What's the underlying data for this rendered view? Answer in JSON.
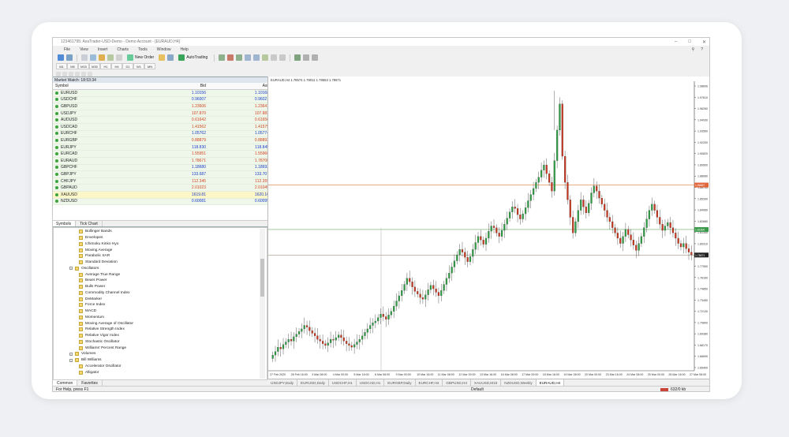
{
  "window": {
    "title": "123461795: AvaTrader-USD-Demo - Demo Account - [EURAUD,H4]"
  },
  "menu": [
    "File",
    "View",
    "Insert",
    "Charts",
    "Tools",
    "Window",
    "Help"
  ],
  "toolbar": {
    "new_order": "New Order",
    "autotrading": "AutoTrading"
  },
  "timeframes": [
    "M1",
    "M5",
    "M15",
    "M30",
    "H1",
    "H4",
    "D1",
    "W1",
    "MN"
  ],
  "market_watch": {
    "header": "Market Watch: 18:53:34",
    "col_symbol": "Symbol",
    "col_bid": "Bid",
    "col_ask": "Ask",
    "rows": [
      {
        "symbol": "EURUSD",
        "bid": "1.10156",
        "ask": "1.10168",
        "dir": "up"
      },
      {
        "symbol": "USDCHF",
        "bid": "0.96007",
        "ask": "0.96021",
        "dir": "up"
      },
      {
        "symbol": "GBPUSD",
        "bid": "1.23606",
        "ask": "1.23641",
        "dir": "dn"
      },
      {
        "symbol": "USDJPY",
        "bid": "107.870",
        "ask": "107.883",
        "dir": "dn"
      },
      {
        "symbol": "AUDUSD",
        "bid": "0.61642",
        "ask": "0.61656",
        "dir": "dn"
      },
      {
        "symbol": "USDCAD",
        "bid": "1.41562",
        "ask": "1.41575",
        "dir": "dn"
      },
      {
        "symbol": "EURCHF",
        "bid": "1.05762",
        "ask": "1.05774",
        "dir": "up"
      },
      {
        "symbol": "EURGBP",
        "bid": "0.88879",
        "ask": "0.88892",
        "dir": "dn"
      },
      {
        "symbol": "EURJPY",
        "bid": "118.830",
        "ask": "118.845",
        "dir": "up"
      },
      {
        "symbol": "EURCAD",
        "bid": "1.55951",
        "ask": "1.55966",
        "dir": "dn"
      },
      {
        "symbol": "EURAUD",
        "bid": "1.78671",
        "ask": "1.78700",
        "dir": "dn"
      },
      {
        "symbol": "GBPCHF",
        "bid": "1.18680",
        "ask": "1.18693",
        "dir": "up"
      },
      {
        "symbol": "GBPJPY",
        "bid": "133.687",
        "ask": "133.707",
        "dir": "up"
      },
      {
        "symbol": "CHFJPY",
        "bid": "112.345",
        "ask": "112.359",
        "dir": "dn"
      },
      {
        "symbol": "GBPAUD",
        "bid": "2.01023",
        "ask": "2.01045",
        "dir": "dn"
      },
      {
        "symbol": "XAUUSD",
        "bid": "1619.81",
        "ask": "1620.10",
        "dir": "up"
      },
      {
        "symbol": "NZDUSD",
        "bid": "0.60081",
        "ask": "0.60099",
        "dir": "up"
      }
    ],
    "tabs": [
      "Symbols",
      "Tick Chart"
    ]
  },
  "navigator": {
    "items": [
      {
        "label": "Bollinger Bands",
        "level": 3
      },
      {
        "label": "Envelopes",
        "level": 3
      },
      {
        "label": "Ichimoku Kinko Hyo",
        "level": 3
      },
      {
        "label": "Moving Average",
        "level": 3
      },
      {
        "label": "Parabolic SAR",
        "level": 3
      },
      {
        "label": "Standard Deviation",
        "level": 3
      },
      {
        "label": "Oscillators",
        "level": 2
      },
      {
        "label": "Average True Range",
        "level": 3
      },
      {
        "label": "Bears Power",
        "level": 3
      },
      {
        "label": "Bulls Power",
        "level": 3
      },
      {
        "label": "Commodity Channel Index",
        "level": 3
      },
      {
        "label": "DeMarker",
        "level": 3
      },
      {
        "label": "Force Index",
        "level": 3
      },
      {
        "label": "MACD",
        "level": 3
      },
      {
        "label": "Momentum",
        "level": 3
      },
      {
        "label": "Moving Average of Oscillator",
        "level": 3
      },
      {
        "label": "Relative Strength Index",
        "level": 3
      },
      {
        "label": "Relative Vigor Index",
        "level": 3
      },
      {
        "label": "Stochastic Oscillator",
        "level": 3
      },
      {
        "label": "Williams' Percent Range",
        "level": 3
      },
      {
        "label": "Volumes",
        "level": 2
      },
      {
        "label": "Bill Williams",
        "level": 2
      },
      {
        "label": "Accelerator Oscillator",
        "level": 3
      },
      {
        "label": "Alligator",
        "level": 3
      }
    ],
    "tabs": [
      "Common",
      "Favorites"
    ]
  },
  "chart": {
    "info": "EURAUD,H4  1.78674 1.79011 1.78553 1.78671",
    "price_labels": [
      "1.98606",
      "1.97610",
      "1.96260",
      "1.94930",
      "1.93560",
      "1.92200",
      "1.90820",
      "1.89500",
      "1.88080",
      "1.86730",
      "1.85390",
      "1.84060",
      "1.82680",
      "1.81340",
      "1.80310",
      "1.78671",
      "1.77550",
      "1.76160",
      "1.74850",
      "1.73450",
      "1.72130",
      "1.70800",
      "1.69380",
      "1.68170",
      "1.66690",
      "1.65400"
    ],
    "date_labels": [
      "27 Feb 2020",
      "28 Feb 16:00",
      "3 Mar 08:00",
      "4 Mar 00:00",
      "5 Mar 16:00",
      "6 Mar 08:00",
      "9 Mar 00:00",
      "10 Mar 16:00",
      "11 Mar 08:00",
      "12 Mar 00:00",
      "13 Mar 16:00",
      "16 Mar 08:00",
      "17 Mar 00:00",
      "18 Mar 16:00",
      "19 Mar 08:00",
      "20 Mar 00:00",
      "23 Mar 16:00",
      "24 Mar 08:00",
      "25 Mar 00:00",
      "26 Mar 16:00",
      "27 Mar 08:00"
    ],
    "hline_price": "1.86667",
    "hline_bid": "1.81600",
    "current_price": "1.78671",
    "bull_color": "#2e9e44",
    "bear_color": "#c8361e",
    "tabs": [
      "USDJPY,Daily",
      "EURUSD,Daily",
      "USDCHF,H1",
      "USDCAD,H1",
      "EURGBP,Daily",
      "EURCHF,H4",
      "GBPUSD,H4",
      "XAUUSD,M15",
      "NZDUSD,Weekly",
      "EURAUD,H4"
    ],
    "active_tab": "EURAUD,H4"
  },
  "status": {
    "help": "For Help, press F1",
    "profile": "Default",
    "traffic": "632/0 kb"
  }
}
